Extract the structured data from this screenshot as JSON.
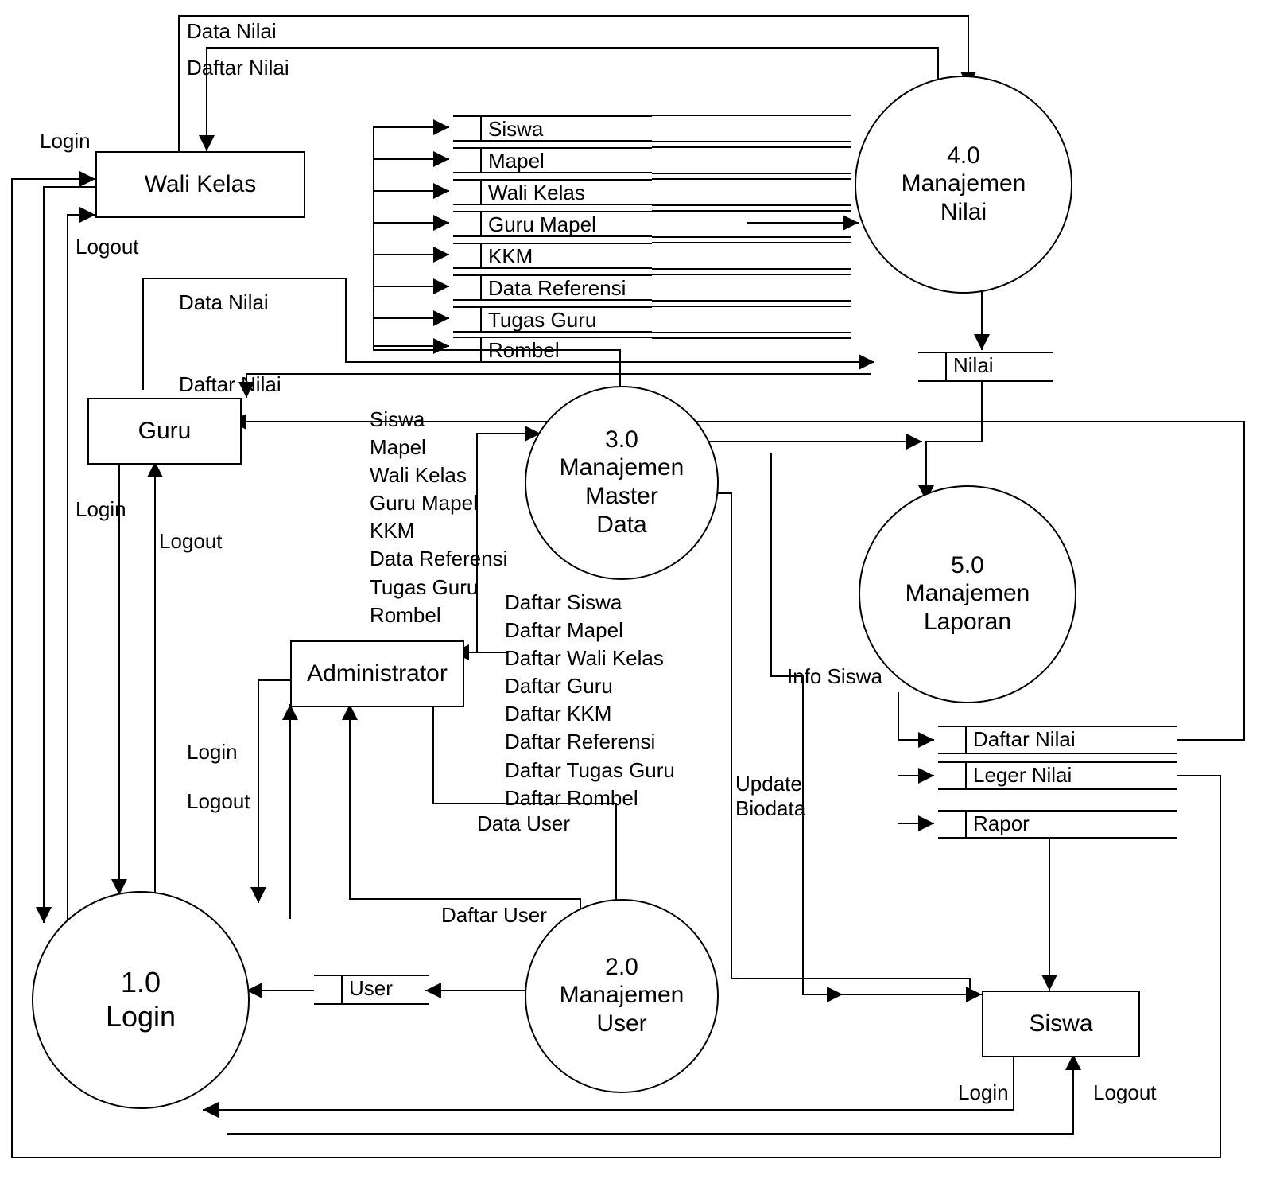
{
  "processes": {
    "p1": {
      "number": "1.0",
      "name": "Login"
    },
    "p2": {
      "number": "2.0",
      "name": "Manajemen\nUser"
    },
    "p3": {
      "number": "3.0",
      "name": "Manajemen\nMaster\nData"
    },
    "p4": {
      "number": "4.0",
      "name": "Manajemen\nNilai"
    },
    "p5": {
      "number": "5.0",
      "name": "Manajemen\nLaporan"
    }
  },
  "entities": {
    "wali_kelas": "Wali Kelas",
    "guru": "Guru",
    "administrator": "Administrator",
    "siswa": "Siswa"
  },
  "stores": {
    "s_siswa": "Siswa",
    "s_mapel": "Mapel",
    "s_wali_kelas": "Wali Kelas",
    "s_guru_mapel": "Guru Mapel",
    "s_kkm": "KKM",
    "s_data_ref": "Data Referensi",
    "s_tugas_guru": "Tugas Guru",
    "s_rombel": "Rombel",
    "s_user": "User",
    "s_nilai": "Nilai",
    "s_daftar_nilai": "Daftar Nilai",
    "s_leger_nilai": "Leger Nilai",
    "s_rapor": "Rapor"
  },
  "flows": {
    "data_nilai_1": "Data Nilai",
    "daftar_nilai_1": "Daftar Nilai",
    "login_wk": "Login",
    "logout_wk": "Logout",
    "data_nilai_2": "Data Nilai",
    "daftar_nilai_2": "Daftar Nilai",
    "login_guru": "Login",
    "logout_guru": "Logout",
    "login_admin": "Login",
    "logout_admin": "Logout",
    "data_user": "Data User",
    "daftar_user": "Daftar User",
    "update_biodata": "Update\nBiodata",
    "info_siswa": "Info Siswa",
    "login_siswa": "Login",
    "logout_siswa": "Logout"
  },
  "lists": {
    "admin_to_p3": "Siswa\nMapel\nWali Kelas\nGuru Mapel\nKKM\nData Referensi\nTugas Guru\nRombel",
    "p3_to_admin": "Daftar Siswa\nDaftar Mapel\nDaftar Wali Kelas\nDaftar Guru\nDaftar KKM\nDaftar Referensi\nDaftar Tugas Guru\nDaftar Rombel"
  },
  "chart_data": {
    "type": "dfd_level_1",
    "processes": [
      {
        "id": "1.0",
        "name": "Login"
      },
      {
        "id": "2.0",
        "name": "Manajemen User"
      },
      {
        "id": "3.0",
        "name": "Manajemen Master Data"
      },
      {
        "id": "4.0",
        "name": "Manajemen Nilai"
      },
      {
        "id": "5.0",
        "name": "Manajemen Laporan"
      }
    ],
    "external_entities": [
      "Wali Kelas",
      "Guru",
      "Administrator",
      "Siswa"
    ],
    "data_stores": [
      "Siswa",
      "Mapel",
      "Wali Kelas",
      "Guru Mapel",
      "KKM",
      "Data Referensi",
      "Tugas Guru",
      "Rombel",
      "User",
      "Nilai",
      "Daftar Nilai",
      "Leger Nilai",
      "Rapor"
    ],
    "data_flows": [
      {
        "from": "Wali Kelas",
        "to": "4.0",
        "label": "Data Nilai"
      },
      {
        "from": "4.0",
        "to": "Wali Kelas",
        "label": "Daftar Nilai"
      },
      {
        "from": "Wali Kelas",
        "to": "1.0",
        "label": "Login"
      },
      {
        "from": "1.0",
        "to": "Wali Kelas",
        "label": "Logout"
      },
      {
        "from": "Guru",
        "to": "4.0",
        "label": "Data Nilai"
      },
      {
        "from": "4.0",
        "to": "Guru",
        "label": "Daftar Nilai"
      },
      {
        "from": "Guru",
        "to": "1.0",
        "label": "Login"
      },
      {
        "from": "1.0",
        "to": "Guru",
        "label": "Logout"
      },
      {
        "from": "Administrator",
        "to": "1.0",
        "label": "Login"
      },
      {
        "from": "1.0",
        "to": "Administrator",
        "label": "Logout"
      },
      {
        "from": "Administrator",
        "to": "3.0",
        "label": "Siswa, Mapel, Wali Kelas, Guru Mapel, KKM, Data Referensi, Tugas Guru, Rombel"
      },
      {
        "from": "3.0",
        "to": "Administrator",
        "label": "Daftar Siswa, Daftar Mapel, Daftar Wali Kelas, Daftar Guru, Daftar KKM, Daftar Referensi, Daftar Tugas Guru, Daftar Rombel"
      },
      {
        "from": "Administrator",
        "to": "2.0",
        "label": "Data User"
      },
      {
        "from": "2.0",
        "to": "Administrator",
        "label": "Daftar User"
      },
      {
        "from": "3.0",
        "to": "Siswa (store)",
        "label": ""
      },
      {
        "from": "3.0",
        "to": "Mapel (store)",
        "label": ""
      },
      {
        "from": "3.0",
        "to": "Wali Kelas (store)",
        "label": ""
      },
      {
        "from": "3.0",
        "to": "Guru Mapel (store)",
        "label": ""
      },
      {
        "from": "3.0",
        "to": "KKM (store)",
        "label": ""
      },
      {
        "from": "3.0",
        "to": "Data Referensi (store)",
        "label": ""
      },
      {
        "from": "3.0",
        "to": "Tugas Guru (store)",
        "label": ""
      },
      {
        "from": "3.0",
        "to": "Rombel (store)",
        "label": ""
      },
      {
        "from": "stores (all 8)",
        "to": "4.0",
        "label": ""
      },
      {
        "from": "Siswa",
        "to": "3.0",
        "label": "Update Biodata"
      },
      {
        "from": "3.0",
        "to": "Siswa",
        "label": "Info Siswa"
      },
      {
        "from": "Siswa",
        "to": "1.0",
        "label": "Login"
      },
      {
        "from": "1.0",
        "to": "Siswa",
        "label": "Logout"
      },
      {
        "from": "2.0",
        "to": "User (store)",
        "label": ""
      },
      {
        "from": "User (store)",
        "to": "1.0",
        "label": ""
      },
      {
        "from": "4.0",
        "to": "Nilai (store)",
        "label": ""
      },
      {
        "from": "Nilai (store)",
        "to": "5.0",
        "label": ""
      },
      {
        "from": "5.0",
        "to": "Daftar Nilai (store)",
        "label": ""
      },
      {
        "from": "5.0",
        "to": "Leger Nilai (store)",
        "label": ""
      },
      {
        "from": "5.0",
        "to": "Rapor (store)",
        "label": ""
      },
      {
        "from": "Daftar Nilai (store)",
        "to": "Wali Kelas",
        "label": ""
      },
      {
        "from": "Daftar Nilai (store)",
        "to": "Guru",
        "label": ""
      },
      {
        "from": "Leger Nilai (store)",
        "to": "Wali Kelas",
        "label": ""
      },
      {
        "from": "Rapor (store)",
        "to": "Siswa",
        "label": ""
      }
    ]
  }
}
